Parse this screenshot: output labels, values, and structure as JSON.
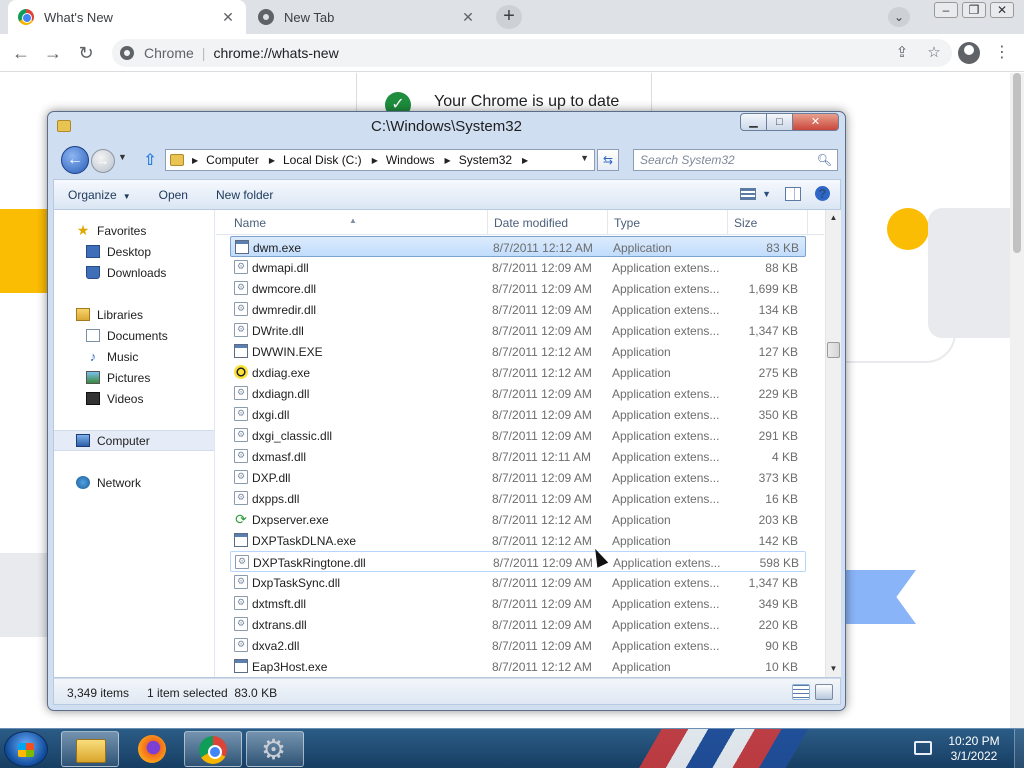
{
  "chrome": {
    "tabs": [
      {
        "title": "What's New",
        "active": true
      },
      {
        "title": "New Tab",
        "active": false
      }
    ],
    "omnibox": {
      "site": "Chrome",
      "url": "chrome://whats-new"
    },
    "page": {
      "status": "Your Chrome is up to date"
    }
  },
  "explorer": {
    "title": "C:\\Windows\\System32",
    "breadcrumb": [
      "Computer",
      "Local Disk (C:)",
      "Windows",
      "System32"
    ],
    "search_placeholder": "Search System32",
    "toolbar": {
      "organize": "Organize",
      "open": "Open",
      "new_folder": "New folder"
    },
    "nav": {
      "favorites": "Favorites",
      "desktop": "Desktop",
      "downloads": "Downloads",
      "libraries": "Libraries",
      "documents": "Documents",
      "music": "Music",
      "pictures": "Pictures",
      "videos": "Videos",
      "computer": "Computer",
      "network": "Network"
    },
    "columns": {
      "name": "Name",
      "date": "Date modified",
      "type": "Type",
      "size": "Size"
    },
    "files": [
      {
        "name": "dwm.exe",
        "date": "8/7/2011 12:12 AM",
        "type": "Application",
        "size": "83 KB",
        "icon": "app"
      },
      {
        "name": "dwmapi.dll",
        "date": "8/7/2011 12:09 AM",
        "type": "Application extens...",
        "size": "88 KB",
        "icon": "dll"
      },
      {
        "name": "dwmcore.dll",
        "date": "8/7/2011 12:09 AM",
        "type": "Application extens...",
        "size": "1,699 KB",
        "icon": "dll"
      },
      {
        "name": "dwmredir.dll",
        "date": "8/7/2011 12:09 AM",
        "type": "Application extens...",
        "size": "134 KB",
        "icon": "dll"
      },
      {
        "name": "DWrite.dll",
        "date": "8/7/2011 12:09 AM",
        "type": "Application extens...",
        "size": "1,347 KB",
        "icon": "dll"
      },
      {
        "name": "DWWIN.EXE",
        "date": "8/7/2011 12:12 AM",
        "type": "Application",
        "size": "127 KB",
        "icon": "app"
      },
      {
        "name": "dxdiag.exe",
        "date": "8/7/2011 12:12 AM",
        "type": "Application",
        "size": "275 KB",
        "icon": "dx"
      },
      {
        "name": "dxdiagn.dll",
        "date": "8/7/2011 12:09 AM",
        "type": "Application extens...",
        "size": "229 KB",
        "icon": "dll"
      },
      {
        "name": "dxgi.dll",
        "date": "8/7/2011 12:09 AM",
        "type": "Application extens...",
        "size": "350 KB",
        "icon": "dll"
      },
      {
        "name": "dxgi_classic.dll",
        "date": "8/7/2011 12:09 AM",
        "type": "Application extens...",
        "size": "291 KB",
        "icon": "dll"
      },
      {
        "name": "dxmasf.dll",
        "date": "8/7/2011 12:11 AM",
        "type": "Application extens...",
        "size": "4 KB",
        "icon": "dll"
      },
      {
        "name": "DXP.dll",
        "date": "8/7/2011 12:09 AM",
        "type": "Application extens...",
        "size": "373 KB",
        "icon": "dll"
      },
      {
        "name": "dxpps.dll",
        "date": "8/7/2011 12:09 AM",
        "type": "Application extens...",
        "size": "16 KB",
        "icon": "dll"
      },
      {
        "name": "Dxpserver.exe",
        "date": "8/7/2011 12:12 AM",
        "type": "Application",
        "size": "203 KB",
        "icon": "sync"
      },
      {
        "name": "DXPTaskDLNA.exe",
        "date": "8/7/2011 12:12 AM",
        "type": "Application",
        "size": "142 KB",
        "icon": "app"
      },
      {
        "name": "DXPTaskRingtone.dll",
        "date": "8/7/2011 12:09 AM",
        "type": "Application extens...",
        "size": "598 KB",
        "icon": "dll"
      },
      {
        "name": "DxpTaskSync.dll",
        "date": "8/7/2011 12:09 AM",
        "type": "Application extens...",
        "size": "1,347 KB",
        "icon": "dll"
      },
      {
        "name": "dxtmsft.dll",
        "date": "8/7/2011 12:09 AM",
        "type": "Application extens...",
        "size": "349 KB",
        "icon": "dll"
      },
      {
        "name": "dxtrans.dll",
        "date": "8/7/2011 12:09 AM",
        "type": "Application extens...",
        "size": "220 KB",
        "icon": "dll"
      },
      {
        "name": "dxva2.dll",
        "date": "8/7/2011 12:09 AM",
        "type": "Application extens...",
        "size": "90 KB",
        "icon": "dll"
      },
      {
        "name": "Eap3Host.exe",
        "date": "8/7/2011 12:12 AM",
        "type": "Application",
        "size": "10 KB",
        "icon": "app"
      }
    ],
    "selected_index": 0,
    "hover_index": 15,
    "status": {
      "count": "3,349 items",
      "selection": "1 item selected  83.0 KB"
    }
  },
  "taskbar": {
    "time": "10:20 PM",
    "date": "3/1/2022"
  }
}
